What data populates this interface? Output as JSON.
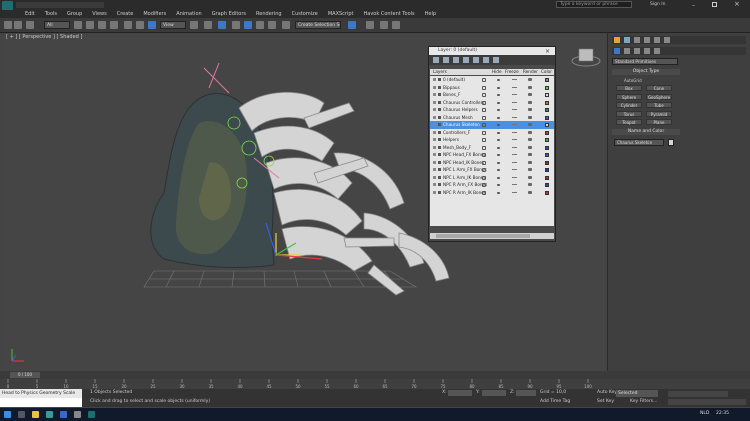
{
  "app": {
    "search_placeholder": "Type a keyword or phrase",
    "sign_in": "Sign In"
  },
  "menu": [
    "Edit",
    "Tools",
    "Group",
    "Views",
    "Create",
    "Modifiers",
    "Animation",
    "Graph Editors",
    "Rendering",
    "Customize",
    "MAXScript",
    "Havok Content Tools",
    "Help"
  ],
  "toolbar": {
    "selection_filter": "All",
    "named_selection": "Create Selection Set",
    "view_dropdown": "View"
  },
  "viewport": {
    "label": "[ + ] [ Perspective ] [ Shaded ]"
  },
  "layer_dialog": {
    "title": "Layer: 0 (default)",
    "columns": [
      "Layers",
      "Hide",
      "Freeze",
      "Render",
      "Color"
    ],
    "rows": [
      {
        "name": "0 (default)",
        "color": "#8a8a8a",
        "selected": false
      },
      {
        "name": "Bippaus",
        "color": "#7fbf3f",
        "selected": false
      },
      {
        "name": "Bones_F",
        "color": "#dcdcdc",
        "selected": false
      },
      {
        "name": "Chaurus Controllers",
        "color": "#b07a2a",
        "selected": false
      },
      {
        "name": "Chaurus Helpers",
        "color": "#2a8a6a",
        "selected": false
      },
      {
        "name": "Chaurus Mesh",
        "color": "#3a5fa0",
        "selected": false
      },
      {
        "name": "Chaurus Skeleton",
        "color": "#d6d6d6",
        "selected": true
      },
      {
        "name": "Controllers_F",
        "color": "#c23a3a",
        "selected": false
      },
      {
        "name": "Helpers",
        "color": "#3ab04a",
        "selected": false
      },
      {
        "name": "Mesh_Body_F",
        "color": "#2f4fb5",
        "selected": false
      },
      {
        "name": "NPC Head_FX Bones",
        "color": "#3a62c0",
        "selected": false
      },
      {
        "name": "NPC Head_IK Bones",
        "color": "#a02a2a",
        "selected": false
      },
      {
        "name": "NPC L Arm_FX Bones",
        "color": "#2a3aa0",
        "selected": false
      },
      {
        "name": "NPC L Arm_IK Bones",
        "color": "#b02a2a",
        "selected": false
      },
      {
        "name": "NPC R Arm_FX Bones",
        "color": "#2a4ab0",
        "selected": false
      },
      {
        "name": "NPC R Arm_IK Bones",
        "color": "#b03a3a",
        "selected": false
      }
    ]
  },
  "command_panel": {
    "category": "Standard Primitives",
    "object_type_label": "Object Type",
    "autogrid": "AutoGrid",
    "primitives": [
      "Box",
      "Cone",
      "Sphere",
      "GeoSphere",
      "Cylinder",
      "Tube",
      "Torus",
      "Pyramid",
      "Teapot",
      "Plane"
    ],
    "name_color_label": "Name and Color",
    "name_field": "Chaurus Skeleton"
  },
  "timeline": {
    "frame_label": "0 / 100",
    "ticks": [
      "0",
      "5",
      "10",
      "15",
      "20",
      "25",
      "30",
      "35",
      "40",
      "45",
      "50",
      "55",
      "60",
      "65",
      "70",
      "75",
      "80",
      "85",
      "90",
      "95",
      "100"
    ]
  },
  "status": {
    "maxscript_text": "Head to Physics Geometry Scale",
    "selection_text": "1 Objects Selected",
    "prompt_text": "Click and drag to select and scale objects (uniformly)",
    "x": "X:",
    "y": "Y:",
    "z": "Z:",
    "grid_text": "Grid = 10,0",
    "time_tag": "Add Time Tag",
    "auto_key": "Auto Key",
    "set_key": "Set Key",
    "key_filter": "Selected",
    "key_filters_btn": "Key Filters..."
  },
  "taskbar": {
    "lang": "NLD",
    "time": "22:35"
  }
}
